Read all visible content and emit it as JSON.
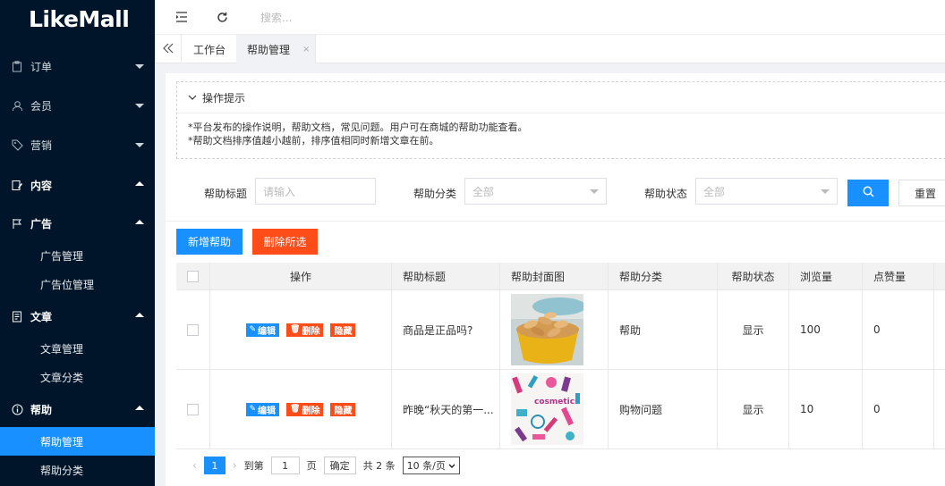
{
  "app": {
    "logo": "LikeMall"
  },
  "sidebar": {
    "items": [
      {
        "label": "订单",
        "icon": "clipboard-icon",
        "expanded": false
      },
      {
        "label": "会员",
        "icon": "user-icon",
        "expanded": false
      },
      {
        "label": "营销",
        "icon": "tag-icon",
        "expanded": false
      },
      {
        "label": "内容",
        "icon": "edit-doc-icon",
        "expanded": true
      },
      {
        "label": "广告",
        "icon": "flag-icon",
        "expanded": true,
        "children": [
          "广告管理",
          "广告位管理"
        ]
      },
      {
        "label": "文章",
        "icon": "document-icon",
        "expanded": true,
        "children": [
          "文章管理",
          "文章分类"
        ]
      },
      {
        "label": "帮助",
        "icon": "info-icon",
        "expanded": true,
        "children": [
          "帮助管理",
          "帮助分类"
        ]
      }
    ],
    "active_sub": "帮助管理"
  },
  "topbar": {
    "search_placeholder": "搜索..."
  },
  "tabs": [
    {
      "label": "工作台",
      "active": false
    },
    {
      "label": "帮助管理",
      "active": true,
      "close": "×"
    }
  ],
  "tips": {
    "title": "操作提示",
    "lines": [
      "*平台发布的操作说明，帮助文档，常见问题。用户可在商城的帮助功能查看。",
      "*帮助文档排序值越小越前，排序值相同时新增文章在前。"
    ]
  },
  "filters": {
    "title_label": "帮助标题",
    "title_placeholder": "请输入",
    "category_label": "帮助分类",
    "category_value": "全部",
    "status_label": "帮助状态",
    "status_value": "全部",
    "reset_label": "重置"
  },
  "actions": {
    "add_label": "新增帮助",
    "delete_label": "删除所选"
  },
  "table": {
    "columns": [
      "操作",
      "帮助标题",
      "帮助封面图",
      "帮助分类",
      "帮助状态",
      "浏览量",
      "点赞量"
    ],
    "row_actions": {
      "edit": "编辑",
      "delete": "删除",
      "hide": "隐藏"
    },
    "rows": [
      {
        "title": "商品是正品吗?",
        "cover": "snack-bowl-image",
        "category": "帮助",
        "status": "显示",
        "views": "100",
        "likes": "0"
      },
      {
        "title": "昨晚“秋天的第一...",
        "cover": "cosmetics-pattern-image",
        "category": "购物问题",
        "status": "显示",
        "views": "10",
        "likes": "0"
      }
    ]
  },
  "pagination": {
    "current": "1",
    "goto_prefix": "到第",
    "goto_value": "1",
    "goto_suffix": "页",
    "confirm": "确定",
    "total": "共 2 条",
    "page_size": "10 条/页"
  },
  "colors": {
    "sidebar_bg": "#001529",
    "primary": "#1890ff",
    "danger": "#ff4d1a"
  }
}
